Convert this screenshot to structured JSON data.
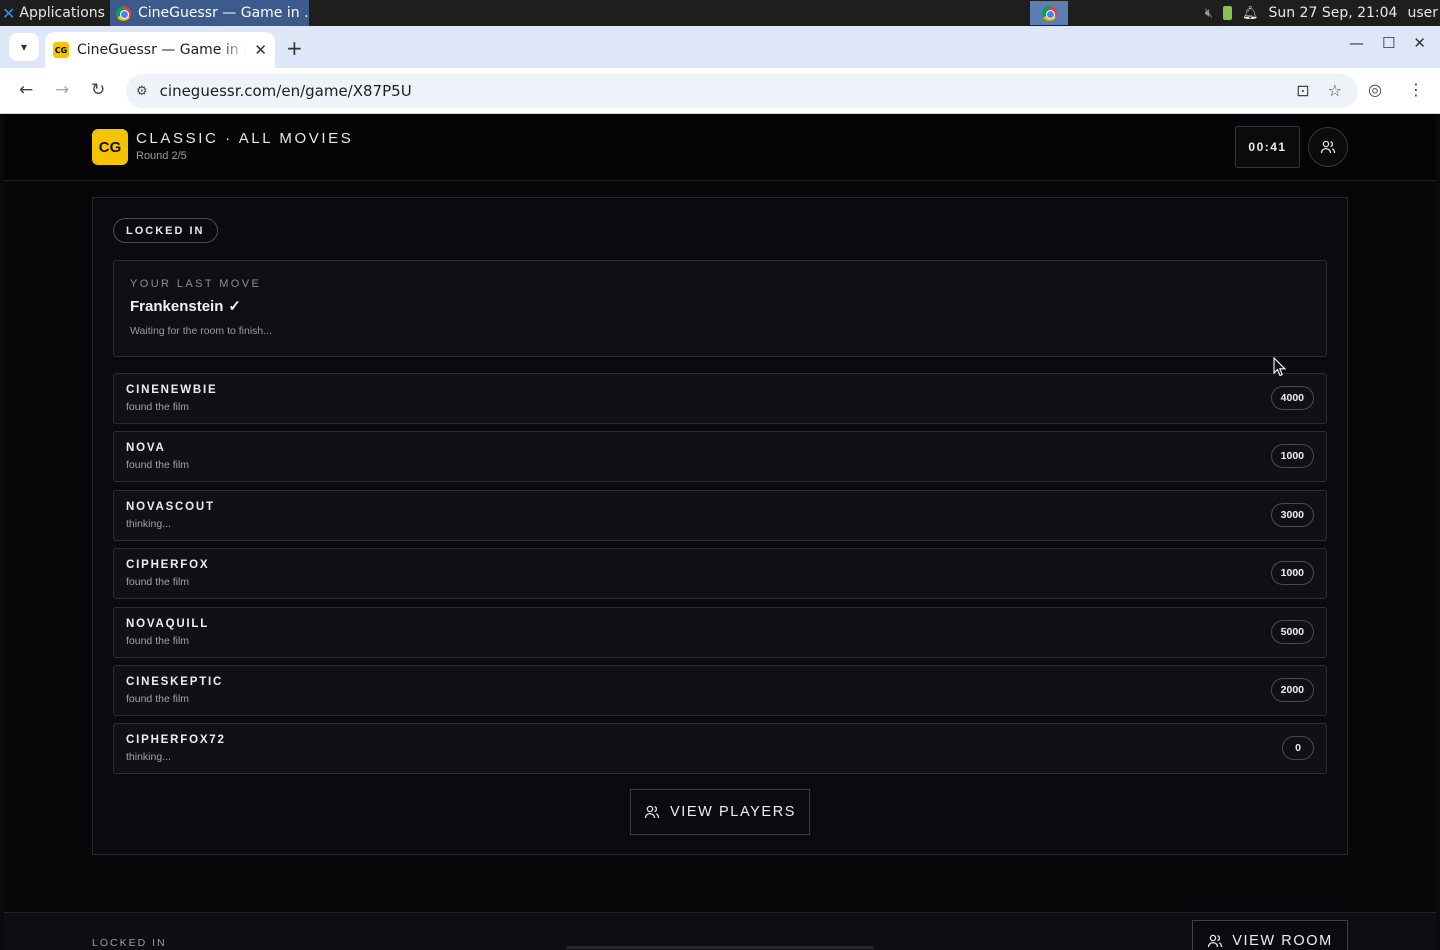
{
  "taskbar": {
    "applications_label": "Applications",
    "window_title": "CineGuessr — Game in ...",
    "datetime": "Sun 27 Sep, 21:04",
    "user": "user"
  },
  "browser": {
    "tab_title": "CineGuessr — Game in progress",
    "favicon_text": "CG",
    "url": "cineguessr.com/en/game/X87P5U"
  },
  "header": {
    "logo_text": "CG",
    "mode_title": "CLASSIC · ALL MOVIES",
    "round_label": "Round 2/5",
    "timer": "00:41"
  },
  "panel": {
    "status_pill": "LOCKED IN",
    "last_move": {
      "label": "YOUR LAST MOVE",
      "movie": "Frankenstein",
      "check": "✓",
      "waiting": "Waiting for the room to finish..."
    },
    "players": [
      {
        "name": "CINENEWBIE",
        "status": "found the film",
        "score": "4000"
      },
      {
        "name": "NOVA",
        "status": "found the film",
        "score": "1000"
      },
      {
        "name": "NOVASCOUT",
        "status": "thinking...",
        "score": "3000"
      },
      {
        "name": "CIPHERFOX",
        "status": "found the film",
        "score": "1000"
      },
      {
        "name": "NOVAQUILL",
        "status": "found the film",
        "score": "5000"
      },
      {
        "name": "CINESKEPTIC",
        "status": "found the film",
        "score": "2000"
      },
      {
        "name": "CIPHERFOX72",
        "status": "thinking...",
        "score": "0"
      }
    ],
    "view_players_label": "VIEW PLAYERS"
  },
  "footer": {
    "status": "LOCKED IN",
    "view_room_label": "VIEW ROOM"
  },
  "colors": {
    "accent": "#f5c400",
    "background": "#07070a",
    "panel": "#0b0b0f"
  }
}
